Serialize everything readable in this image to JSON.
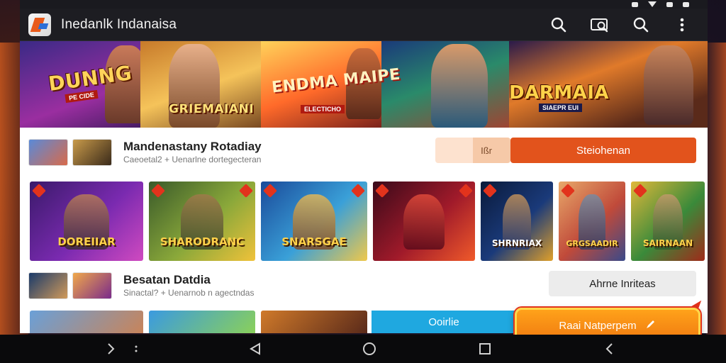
{
  "app": {
    "title": "Inedanlk Indanaisa"
  },
  "banner": {
    "titles": [
      "DUNNG",
      "GRIEMAIANI",
      "ENDMA MAIPE",
      "DARMAIA"
    ],
    "subs": [
      "PE CIDE",
      "ELECTICHO",
      "SIAEPR EUI"
    ]
  },
  "row1": {
    "title": "Mandenastany Rotadiay",
    "subtitle": "Caeoetal2 + Uenarlne dortegecteran",
    "seg_label": "Ißr",
    "button": "Steiohenan"
  },
  "games": [
    {
      "label": "DOREIIAR",
      "colors": [
        "#3a1a6a",
        "#7a2ab0",
        "#d04ac0"
      ]
    },
    {
      "label": "SHARODRANC",
      "colors": [
        "#3a5a2a",
        "#8aa83a",
        "#f0c23a"
      ]
    },
    {
      "label": "SNARSGAE",
      "colors": [
        "#1a4a9a",
        "#3aa0d8",
        "#f0c84a"
      ]
    },
    {
      "label": "",
      "colors": [
        "#3a0a1a",
        "#a01a2a",
        "#f05a2a"
      ]
    },
    {
      "label": "SHRNRIAX",
      "colors": [
        "#0a1a3a",
        "#1a3a7a",
        "#e0a02a"
      ]
    },
    {
      "label": "GRGSAADIR",
      "colors": [
        "#e8a86a",
        "#c04a3a",
        "#3a4a8a"
      ]
    },
    {
      "label": "SAIRNAAN",
      "colors": [
        "#e0b83a",
        "#3a8a3a",
        "#a02a1a"
      ]
    }
  ],
  "row2": {
    "title": "Besatan Datdia",
    "subtitle": "Sinactal? + Uenarnob n agectndas",
    "button": "Ahrne Inriteas"
  },
  "row3": {
    "cyan_button": "Ooirlie",
    "float_button": "Raai Natperpem"
  },
  "accent": {
    "primary": "#e2531c",
    "cyan": "#1fa8e0",
    "float": "#f08a14"
  },
  "icons": [
    "search-icon",
    "camera-search-icon",
    "search-icon",
    "more-vert-icon",
    "back-icon",
    "home-icon",
    "recents-icon"
  ]
}
